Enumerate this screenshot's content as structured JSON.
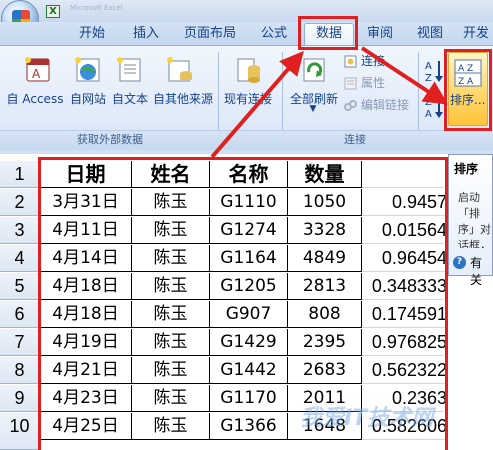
{
  "window": {
    "caption": "Microsoft Excel"
  },
  "tabs": [
    "开始",
    "插入",
    "页面布局",
    "公式",
    "数据",
    "审阅",
    "视图",
    "开发"
  ],
  "ribbon": {
    "external_data": {
      "group_label": "获取外部数据",
      "buttons": [
        "自 Access",
        "自网站",
        "自文本",
        "自其他来源",
        "现有连接"
      ]
    },
    "connections": {
      "group_label": "连接",
      "refresh_all": "全部刷新",
      "items": [
        "连接",
        "属性",
        "编辑链接"
      ]
    },
    "sort": {
      "az": "A Z",
      "za": "Z A",
      "sort_label": "排序..."
    }
  },
  "sheet": {
    "row_headers": [
      "1",
      "2",
      "3",
      "4",
      "5",
      "6",
      "7",
      "8",
      "9",
      "10"
    ],
    "columns": [
      "日期",
      "姓名",
      "名称",
      "数量"
    ],
    "rows": [
      [
        "3月31日",
        "陈玉",
        "G1110",
        "1050",
        "0.9457"
      ],
      [
        "4月11日",
        "陈玉",
        "G1274",
        "3328",
        "0.01564"
      ],
      [
        "4月14日",
        "陈玉",
        "G1164",
        "4849",
        "0.96454"
      ],
      [
        "4月18日",
        "陈玉",
        "G1205",
        "2813",
        "0.348333"
      ],
      [
        "4月18日",
        "陈玉",
        "G907",
        "808",
        "0.174591"
      ],
      [
        "4月19日",
        "陈玉",
        "G1429",
        "2395",
        "0.976825"
      ],
      [
        "4月21日",
        "陈玉",
        "G1442",
        "2683",
        "0.562322"
      ],
      [
        "4月23日",
        "陈玉",
        "G1170",
        "2011",
        "0.2363"
      ],
      [
        "4月25日",
        "陈玉",
        "G1366",
        "1648",
        "0.582606"
      ]
    ]
  },
  "tooltip": {
    "title": "排序",
    "body": "启动「排序」对话框，可根据多个条件对数据排序。",
    "help": "有关"
  },
  "watermark": "我爱IT技术网",
  "colors": {
    "annotation": "#e02020",
    "ribbon_text": "#15428b"
  }
}
